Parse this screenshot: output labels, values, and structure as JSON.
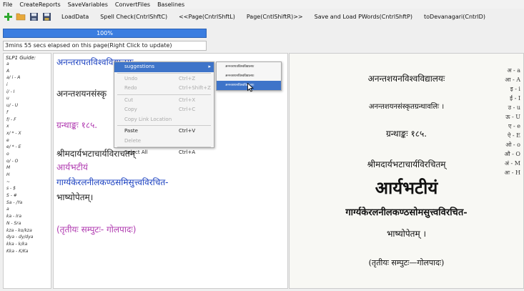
{
  "menu": [
    "File",
    "CreateReports",
    "SaveVariables",
    "ConvertFiles",
    "Baselines"
  ],
  "toolbar": {
    "icons": [
      "add-icon",
      "open-folder-icon",
      "save-icon",
      "save-as-icon"
    ],
    "buttons": [
      "LoadData",
      "Spell Check(CntrlShftC)",
      "<<Page(CntrlShftL)",
      "Page(CntlShiftR)>>",
      "Save and Load PWords(CntrlShftP)",
      "toDevanagari(CntrlD)"
    ]
  },
  "progress": {
    "label": "100%",
    "value": 1.0
  },
  "status": "3mins 55 secs elapsed on this page(Right Click to update)",
  "guide": {
    "title": "SLP1 Guide:",
    "rows": [
      "a",
      "A",
      "a/ i - A",
      "i",
      "i/ - I",
      "u",
      "u/ - U",
      "f",
      "f/ - F",
      "x",
      "x/ * - X",
      "e",
      "e/ * - E",
      "o",
      "o/ - O",
      "M",
      "H",
      "~",
      "s - $",
      "S - #",
      "Sa - /Ya",
      "a",
      "ka - Ira",
      "N - Sra",
      "kza - ko/kza",
      "dya - dy/dya",
      "kka - k/ka",
      "Kka - K/Ka"
    ]
  },
  "editor": {
    "lines": [
      {
        "text": "अनन्तरापतविश्वविद्यालयः",
        "color": "#1a40c0"
      },
      {
        "text": "अनन्तशयनसंस्कृ",
        "color": "#222222"
      },
      {
        "text": "ग्रन्थाङ्कः १८५.",
        "color": "#b03ab0"
      },
      {
        "text": "श्रीमदार्यभटाचार्यविराचतम्",
        "color": "#222222"
      },
      {
        "text": "आर्यभटीयं",
        "color": "#b03ab0"
      },
      {
        "text": "गार्ग्यकेरलनीलकण्ठसमिसुत्त्वविरचित-",
        "color": "#1a40c0"
      },
      {
        "text": "भाष्योपेतम्।",
        "color": "#222222"
      },
      {
        "text": "(तृतीयः सम्पुटः- गोलपादः)",
        "color": "#b03ab0"
      }
    ]
  },
  "context_menu": {
    "items": [
      {
        "label": "suggestions",
        "shortcut": "",
        "state": "highlighted",
        "submenu": true
      },
      {
        "label": "Undo",
        "shortcut": "Ctrl+Z",
        "state": "disabled"
      },
      {
        "label": "Redo",
        "shortcut": "Ctrl+Shift+Z",
        "state": "disabled"
      },
      {
        "label": "Cut",
        "shortcut": "Ctrl+X",
        "state": "disabled"
      },
      {
        "label": "Copy",
        "shortcut": "Ctrl+C",
        "state": "disabled"
      },
      {
        "label": "Copy Link Location",
        "shortcut": "",
        "state": "disabled"
      },
      {
        "label": "Paste",
        "shortcut": "Ctrl+V",
        "state": "enabled"
      },
      {
        "label": "Delete",
        "shortcut": "",
        "state": "disabled"
      },
      {
        "label": "Select All",
        "shortcut": "Ctrl+A",
        "state": "enabled"
      }
    ],
    "suggestions": [
      "अनन्तरापतविश्वविद्यालयः",
      "अनन्तशयनविश्वविद्यालयः",
      "अनन्तशयनविश्वविद्यालयः"
    ]
  },
  "scan": {
    "lines": [
      "अनन्तशयनविश्वविद्यालयः",
      "अनन्तशयनसंस्कृतग्रन्थावलिः ।",
      "ग्रन्थाङ्कः १८५.",
      "श्रीमदार्यभटाचार्यविरचितम्",
      "आर्यभटीयं",
      "गार्ग्यकेरलनीलकण्ठसोमसुत्त्वविरचित-",
      "भाष्योपेतम् ।",
      "(तृतीयः सम्पुटः—गोलपादः)"
    ],
    "side_marks": [
      "अ - a",
      "आ - A",
      "इ - i",
      "ई - I",
      "उ - u",
      "ऊ - U",
      "ए - e",
      "ऐ - E",
      "ओ - o",
      "औ - O",
      "अं - M",
      "अः - H"
    ]
  }
}
